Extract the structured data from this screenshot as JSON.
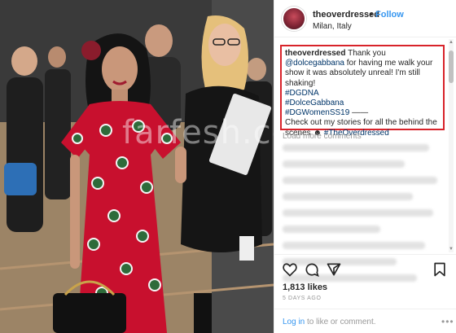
{
  "photo": {
    "watermark": "farfesh.com"
  },
  "post": {
    "username": "theoverdressed",
    "separator": "•",
    "follow_label": "Follow",
    "location": "Milan, Italy"
  },
  "caption": {
    "username": "theoverdressed",
    "text_before": " Thank you ",
    "mention": "@dolcegabbana",
    "text_after": " for having me walk your show it was absolutely unreal! I'm still shaking!",
    "hashtag1": "#DGDNA",
    "hashtag2": "#DolceGabbana",
    "hashtag3": "#DGWomenSS19",
    "dash": " ——",
    "closing": "Check out my stories for all the behind the scenes ☻ ",
    "hashtag4": "#TheOverdressed"
  },
  "comments": {
    "load_label": "Load more comments"
  },
  "actions": {
    "like_icon": "heart-icon",
    "comment_icon": "comment-icon",
    "share_icon": "share-icon",
    "save_icon": "bookmark-icon",
    "likes": "1,813 likes",
    "age": "5 DAYS AGO"
  },
  "login": {
    "link": "Log in",
    "rest": " to like or comment.",
    "more_icon": "ellipsis-icon"
  },
  "colors": {
    "accent": "#3897f0",
    "highlight_border": "#d8232a",
    "dress_red": "#c8102e",
    "dress_green": "#2e6b3a"
  }
}
